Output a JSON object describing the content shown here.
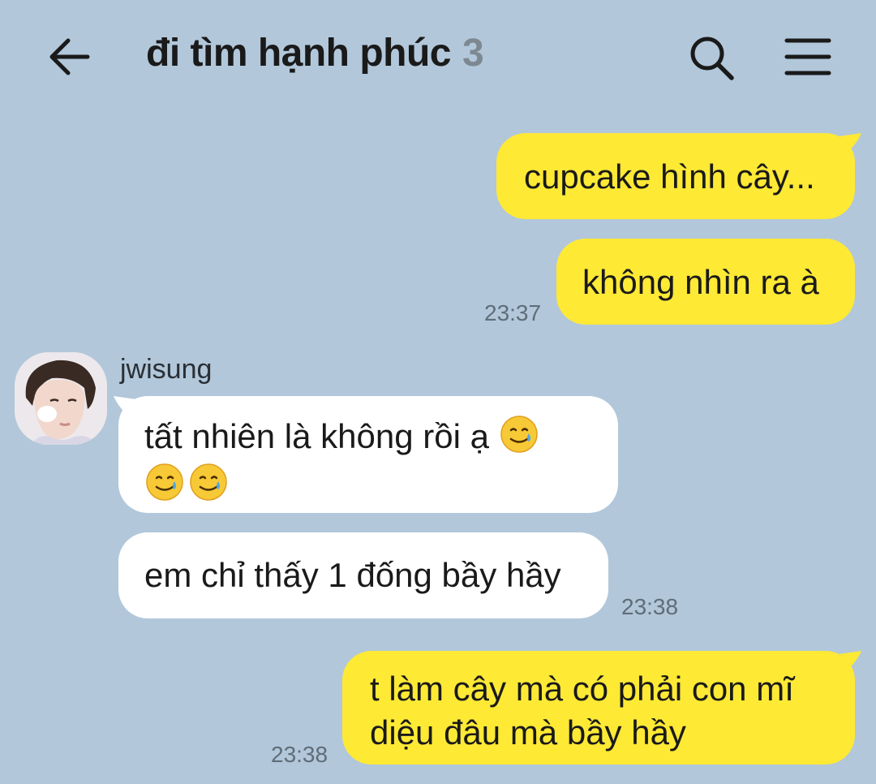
{
  "header": {
    "title": "đi tìm hạnh phúc",
    "member_count": "3",
    "back_icon": "arrow-left-icon",
    "search_icon": "search-icon",
    "menu_icon": "hamburger-menu-icon"
  },
  "colors": {
    "background": "#b2c7da",
    "my_bubble": "#fee935",
    "other_bubble": "#ffffff"
  },
  "messages": {
    "m1": {
      "text": "cupcake hình cây..."
    },
    "m2": {
      "text": "không nhìn ra à",
      "time": "23:37"
    },
    "sender": "jwisung",
    "m3": {
      "text": "tất nhiên là không rồi ạ",
      "emoji": "smiling-face-with-tear"
    },
    "m4": {
      "text": "em chỉ thấy 1 đống bầy hầy",
      "time": "23:38"
    },
    "m5": {
      "line1": "t làm cây mà có phải con mĩ",
      "line2": "diệu đâu mà bầy hầy",
      "time": "23:38"
    }
  }
}
